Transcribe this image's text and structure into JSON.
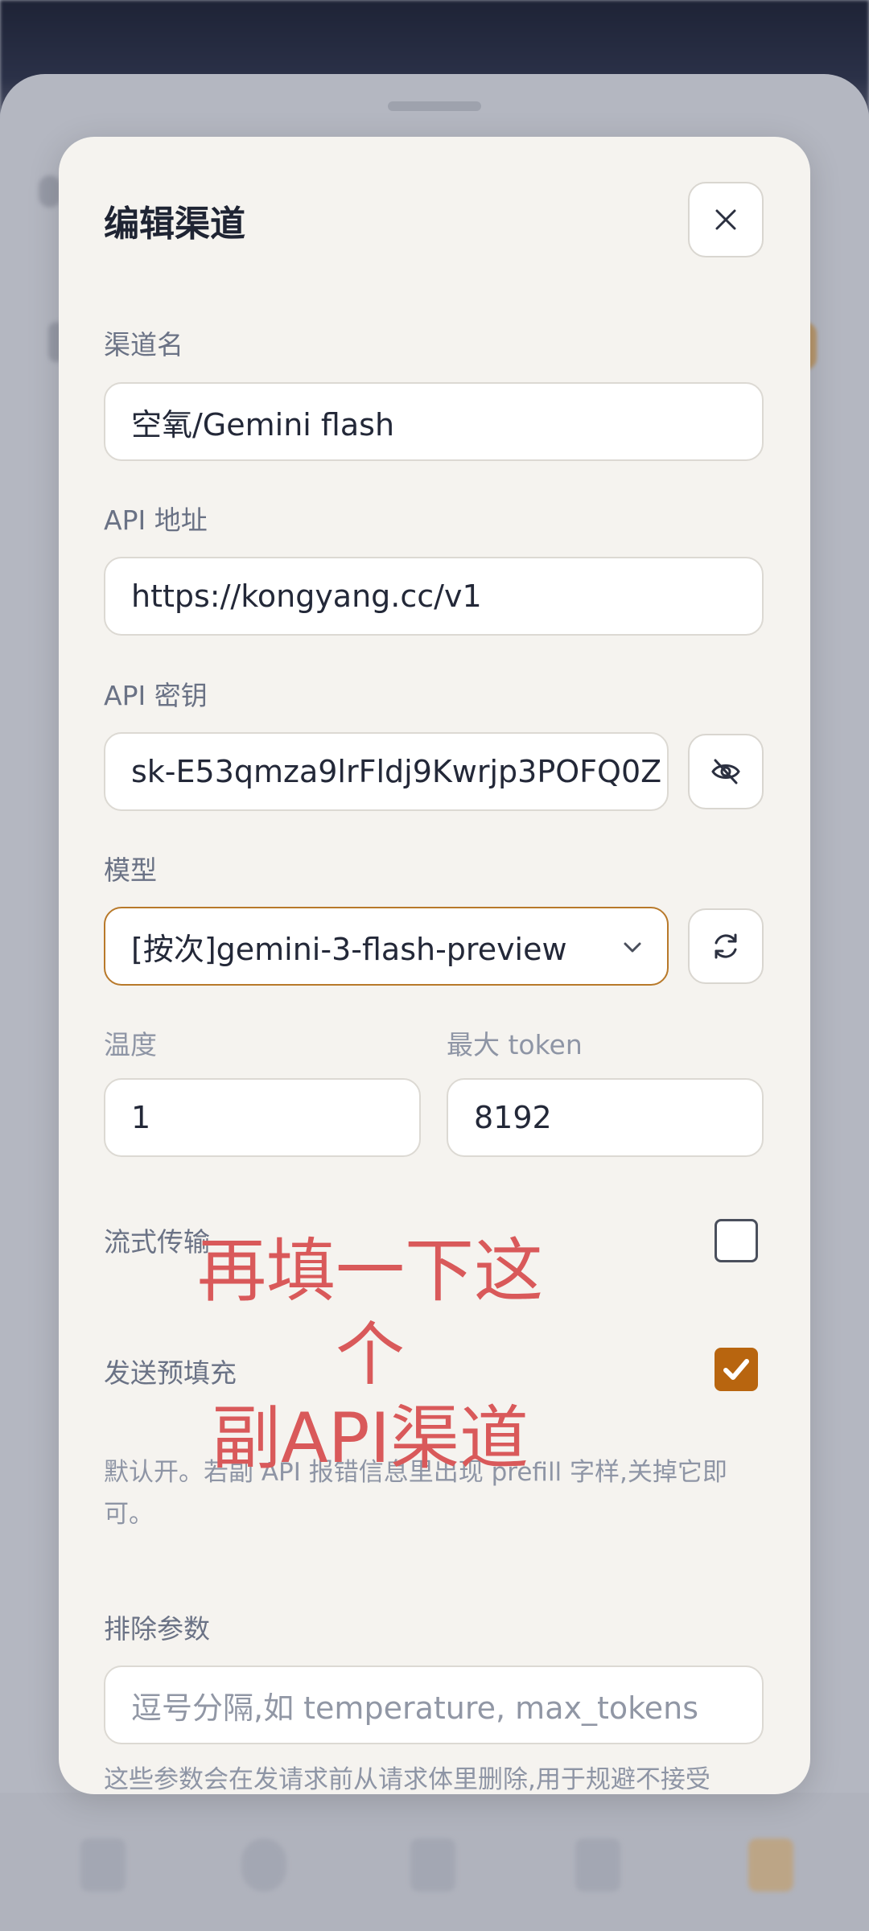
{
  "dialog": {
    "title": "编辑渠道",
    "close_icon": "close-icon"
  },
  "fields": {
    "channel_name": {
      "label": "渠道名",
      "value": "空氧/Gemini flash"
    },
    "api_url": {
      "label": "API 地址",
      "value": "https://kongyang.cc/v1"
    },
    "api_key": {
      "label": "API 密钥",
      "value": "sk-E53qmza9lrFldj9Kwrjp3POFQ0Z",
      "toggle_icon": "eye-off-icon"
    },
    "model": {
      "label": "模型",
      "value": "[按次]gemini-3-flash-preview",
      "refresh_icon": "refresh-icon"
    },
    "temperature": {
      "label": "温度",
      "value": "1"
    },
    "max_token": {
      "label": "最大 token",
      "value": "8192"
    },
    "stream": {
      "label": "流式传输",
      "checked": false
    },
    "prefill": {
      "label": "发送预填充",
      "checked": true
    },
    "prefill_hint": "默认开。若副 API 报错信息里出现 prefill 字样,关掉它即可。",
    "exclude_params": {
      "label": "排除参数",
      "placeholder": "逗号分隔,如 temperature, max_tokens",
      "hint": "这些参数会在发请求前从请求体里删除,用于规避不接受"
    }
  },
  "annotation": {
    "line1": "再填一下这个",
    "line2": "副API渠道"
  },
  "colors": {
    "accent": "#b8650f",
    "annotation": "#d9595a"
  }
}
